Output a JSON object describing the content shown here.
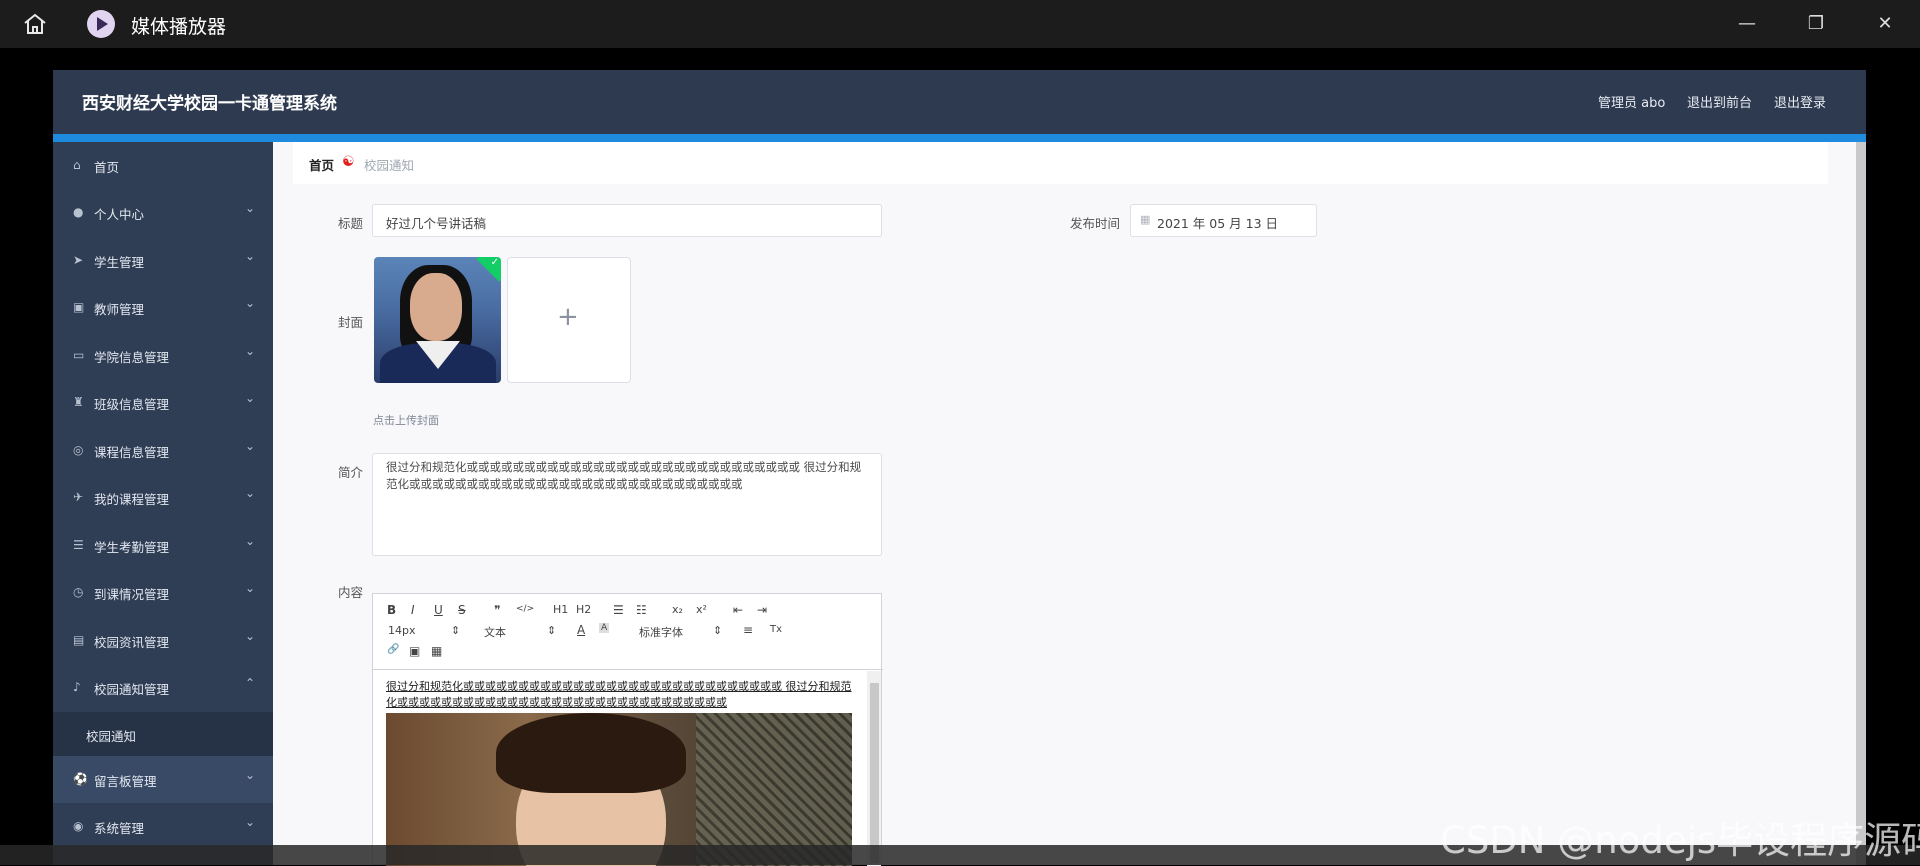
{
  "player": {
    "title": "媒体播放器",
    "icons": [
      "home-icon",
      "media-player-logo-icon",
      "minimize-icon",
      "restore-icon",
      "close-icon"
    ]
  },
  "app": {
    "title": "西安财经大学校园一卡通管理系统",
    "user_label": "管理员 abo",
    "to_front_label": "退出到前台",
    "logout_label": "退出登录"
  },
  "sidebar": {
    "items": [
      {
        "label": "首页",
        "icon": "home-icon"
      },
      {
        "label": "个人中心",
        "icon": "user-icon"
      },
      {
        "label": "学生管理",
        "icon": "send-icon"
      },
      {
        "label": "教师管理",
        "icon": "clipboard-icon"
      },
      {
        "label": "学院信息管理",
        "icon": "monitor-icon"
      },
      {
        "label": "班级信息管理",
        "icon": "trophy-icon"
      },
      {
        "label": "课程信息管理",
        "icon": "circle-icon"
      },
      {
        "label": "我的课程管理",
        "icon": "paper-plane-icon"
      },
      {
        "label": "学生考勤管理",
        "icon": "sliders-icon"
      },
      {
        "label": "到课情况管理",
        "icon": "clock-icon"
      },
      {
        "label": "校园资讯管理",
        "icon": "document-icon"
      },
      {
        "label": "校园通知管理",
        "icon": "microphone-icon"
      },
      {
        "label": "留言板管理",
        "icon": "football-icon"
      },
      {
        "label": "系统管理",
        "icon": "compass-icon"
      }
    ],
    "sub_item": "校园通知"
  },
  "breadcrumb": {
    "home": "首页",
    "current": "校园通知"
  },
  "form": {
    "title_label": "标题",
    "title_value": "好过几个号讲话稿",
    "publish_label": "发布时间",
    "publish_value": "2021 年 05 月 13 日",
    "cover_label": "封面",
    "upload_hint": "点击上传封面",
    "intro_label": "简介",
    "intro_value": "  很过分和规范化或或或或或或或或或或或或或或或或或或或或或或或或或或或或或  很过分和规范化或或或或或或或或或或或或或或或或或或或或或或或或或或或或或",
    "content_label": "内容",
    "content_text": " 很过分和规范化或或或或或或或或或或或或或或或或或或或或或或或或或或或或或 很过分和规范化或或或或或或或或或或或或或或或或或或或或或或或或或或或或或或"
  },
  "editor": {
    "font_size": "14px",
    "paragraph": "文本",
    "font_family": "标准字体",
    "buttons": {
      "bold": "B",
      "italic": "I",
      "underline": "U",
      "strike": "S",
      "quote": "❞",
      "code": "</>",
      "h1": "H1",
      "h2": "H2",
      "ordered": "☰",
      "bullet": "☷",
      "sub": "x₂",
      "sup": "x²",
      "outdent": "⇤",
      "indent": "⇥",
      "color": "A",
      "background": "A",
      "align": "≡",
      "clean": "Tx",
      "link": "🔗",
      "image": "▣",
      "video": "▦"
    }
  },
  "watermark": "CSDN @nodejs毕设程序源码"
}
